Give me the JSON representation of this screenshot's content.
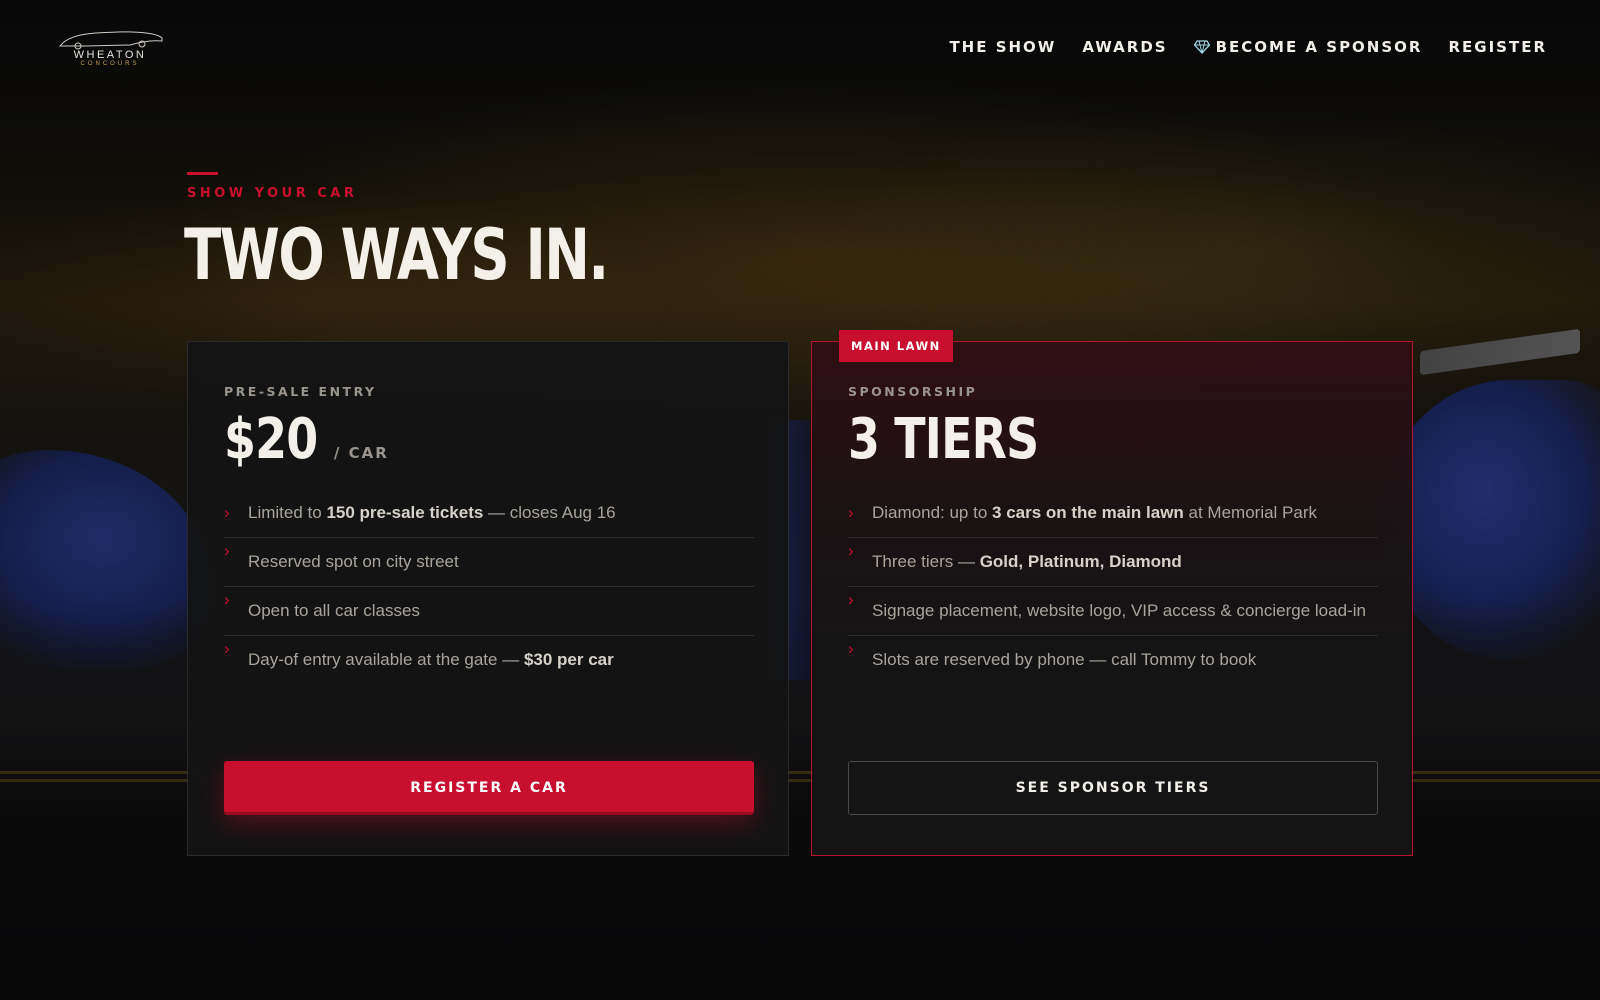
{
  "brand": {
    "name": "WHEATON",
    "sub": "CONCOURS"
  },
  "nav": {
    "items": [
      {
        "label": "THE SHOW"
      },
      {
        "label": "AWARDS"
      },
      {
        "label": "BECOME A SPONSOR",
        "icon": "diamond-icon"
      },
      {
        "label": "REGISTER"
      }
    ]
  },
  "hero": {
    "eyebrow": "SHOW YOUR CAR",
    "headline": "TWO WAYS IN."
  },
  "cards": [
    {
      "kicker": "PRE-SALE ENTRY",
      "price": "$20",
      "unit": "/ CAR",
      "features": [
        {
          "pre": "Limited to ",
          "bold": "150 pre-sale tickets",
          "post": " — closes Aug 16"
        },
        {
          "pre": "Reserved spot on city street",
          "bold": "",
          "post": ""
        },
        {
          "pre": "Open to all car classes",
          "bold": "",
          "post": ""
        },
        {
          "pre": "Day-of entry available at the gate — ",
          "bold": "$30 per car",
          "post": ""
        }
      ],
      "button": "REGISTER A CAR"
    },
    {
      "badge": "MAIN LAWN",
      "kicker": "SPONSORSHIP",
      "price": "3 TIERS",
      "features": [
        {
          "pre": "Diamond: up to ",
          "bold": "3 cars on the main lawn",
          "post": " at Memorial Park"
        },
        {
          "pre": "Three tiers — ",
          "bold": "Gold, Platinum, Diamond",
          "post": ""
        },
        {
          "pre": "Signage placement, website logo, VIP access & concierge load-in",
          "bold": "",
          "post": ""
        },
        {
          "pre": "Slots are reserved by phone — call Tommy to book",
          "bold": "",
          "post": ""
        }
      ],
      "button": "SEE SPONSOR TIERS"
    }
  ],
  "colors": {
    "accent": "#c8102e",
    "background": "#0b0b0c",
    "card": "#141415",
    "text": "#f2efe9",
    "muted": "#a9a49b"
  }
}
